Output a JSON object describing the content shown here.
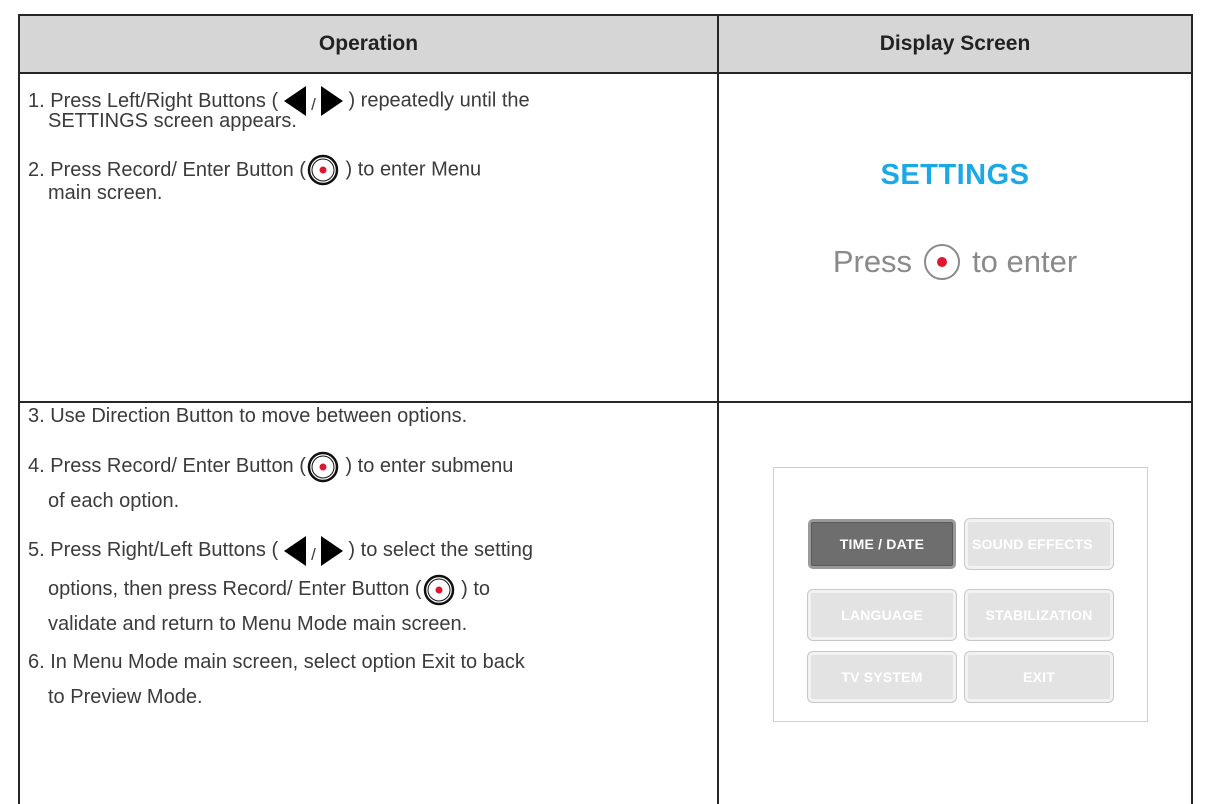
{
  "header": {
    "operation": "Operation",
    "display_screen": "Display Screen"
  },
  "row1": {
    "step1": {
      "number": "1.",
      "a": "Press Left/Right Buttons (",
      "slash": "/",
      "b": ") repeatedly until the",
      "line2": "SETTINGS screen appears."
    },
    "step2": {
      "number": "2.",
      "a": "Press Record/ Enter Button (",
      "b": ") to enter Menu",
      "line2": "main screen."
    },
    "display": {
      "title": "SETTINGS",
      "press": "Press",
      "to_enter": "to enter"
    }
  },
  "row2": {
    "step3": "3. Use Direction Button to move between options.",
    "step4": {
      "a": "4. Press Record/ Enter Button (",
      "b": ") to enter submenu",
      "line2": "of each option."
    },
    "step5": {
      "a": "5. Press Right/Left Buttons (",
      "slash": "/",
      "b": ") to select the setting",
      "line2a": "options, then press Record/ Enter Button (",
      "line2b": ") to",
      "line3": "validate and return to Menu Mode main screen."
    },
    "step6": {
      "line1": "6. In Menu Mode main screen, select option Exit to back",
      "line2": "to Preview Mode."
    },
    "menu": {
      "items": [
        "TIME / DATE",
        "SOUND EFFECTS",
        "LANGUAGE",
        "STABILIZATION",
        "TV SYSTEM",
        "EXIT"
      ],
      "selected": "TIME / DATE"
    }
  },
  "colors": {
    "accent_blue": "#1ba8e6",
    "record_red": "#e0152f",
    "header_gray": "#d6d6d6"
  },
  "icons": [
    "left-triangle-icon",
    "right-triangle-icon",
    "record-enter-icon"
  ]
}
